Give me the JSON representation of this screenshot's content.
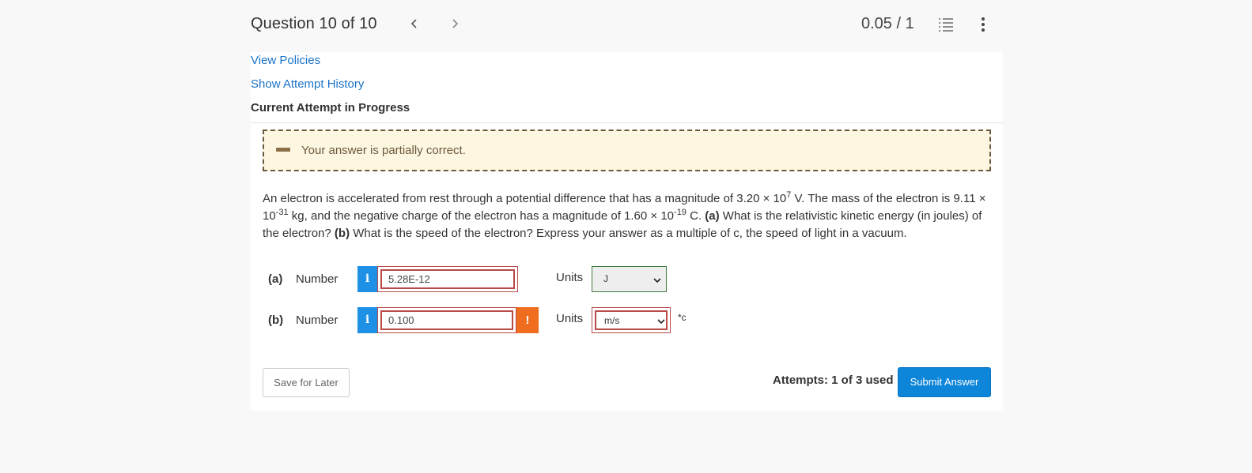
{
  "header": {
    "question_title": "Question 10 of 10",
    "prev_icon": "chevron-left-icon",
    "next_icon": "chevron-right-icon",
    "score": "0.05 / 1",
    "list_icon": "numbered-list-icon",
    "menu_icon": "vertical-ellipsis-icon"
  },
  "links": {
    "view_policies": "View Policies",
    "show_history": "Show Attempt History"
  },
  "attempt_status": "Current Attempt in Progress",
  "feedback": {
    "icon": "minus-icon",
    "text": "Your answer is partially correct.",
    "colors": {
      "background": "#fdf6e0",
      "border": "#6b5a3d"
    }
  },
  "question": {
    "p1": "An electron is accelerated from rest through a potential difference that has a magnitude of 3.20 × 10",
    "exp1": "7",
    "p2": " V. The mass of the electron is 9.11 × 10",
    "exp2": "-31",
    "p3": " kg, and the negative charge of the electron has a magnitude of 1.60 × 10",
    "exp3": "-19",
    "p4": " C. ",
    "a_tag": "(a)",
    "p5": " What is the relativistic kinetic energy (in joules) of the electron? ",
    "b_tag": "(b)",
    "p6": " What is the speed of the electron? Express your answer as a multiple of c, the speed of light in a vacuum."
  },
  "answers": {
    "a": {
      "part": "(a)",
      "label": "Number",
      "info": "i",
      "value": "5.28E-12",
      "units_label": "Units",
      "units_value": "J"
    },
    "b": {
      "part": "(b)",
      "label": "Number",
      "info": "i",
      "value": "0.100",
      "warning": "!",
      "units_label": "Units",
      "units_value": "m/s",
      "suffix": "*c"
    }
  },
  "footer": {
    "save_label": "Save for Later",
    "attempts": "Attempts: 1 of 3 used",
    "submit_label": "Submit Answer"
  },
  "colors": {
    "link": "#1a73c8",
    "info": "#1e90e6",
    "warning": "#f06c1e",
    "error_border": "#b94a48",
    "correct_border": "#3c7a3c",
    "submit": "#0d85d8"
  }
}
